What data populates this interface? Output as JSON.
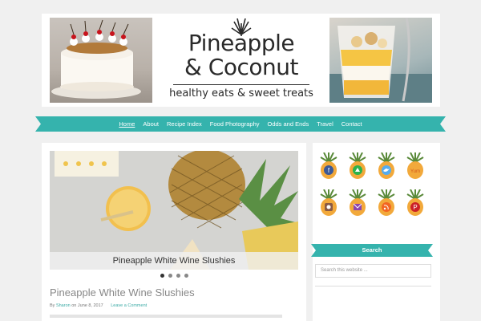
{
  "header": {
    "logo_line1": "Pineapple",
    "logo_line2": "& Coconut",
    "tagline": "healthy eats & sweet treats"
  },
  "nav": {
    "items": [
      {
        "label": "Home",
        "active": true
      },
      {
        "label": "About"
      },
      {
        "label": "Recipe Index"
      },
      {
        "label": "Food Photography"
      },
      {
        "label": "Odds and Ends"
      },
      {
        "label": "Travel"
      },
      {
        "label": "Contact"
      }
    ]
  },
  "slider": {
    "caption": "Pineapple White Wine Slushies",
    "dot_count": 4,
    "active_dot": 1
  },
  "post": {
    "title": "Pineapple White Wine Slushies",
    "by": "By",
    "author": "Sharon",
    "on": "on June 8, 2017",
    "comment": "Leave a Comment"
  },
  "sidebar": {
    "social_icons": [
      "facebook-icon",
      "feedly-icon",
      "twitter-icon",
      "yummly-icon",
      "instagram-icon",
      "email-icon",
      "rss-icon",
      "pinterest-icon"
    ],
    "search_title": "Search",
    "search_placeholder": "Search this website ..."
  },
  "colors": {
    "accent": "#35b3ad",
    "accent_dark": "#1f8e89",
    "pineapple": "#f2a93b",
    "pineapple_leaf": "#5a8a3a"
  }
}
